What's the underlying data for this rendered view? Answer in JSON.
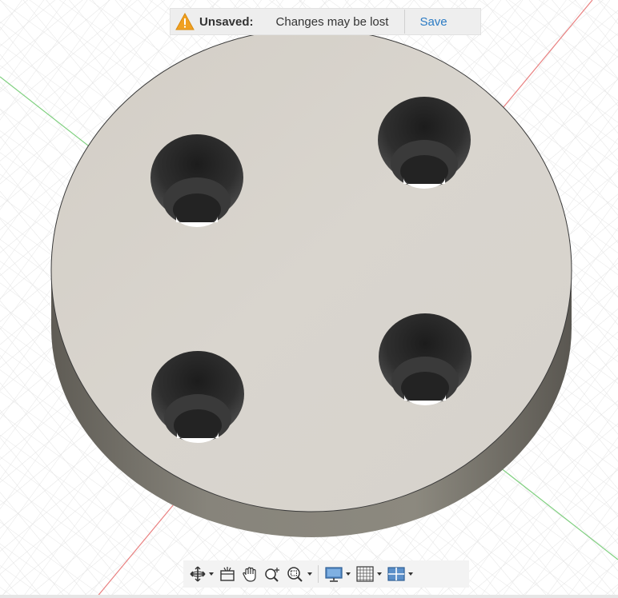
{
  "banner": {
    "status_label": "Unsaved:",
    "message": "Changes may be lost",
    "save_label": "Save"
  },
  "navbar": {
    "tools": [
      {
        "icon": "orbit-icon",
        "has_dropdown": true
      },
      {
        "icon": "look-at-icon",
        "has_dropdown": false
      },
      {
        "icon": "pan-icon",
        "has_dropdown": false
      },
      {
        "icon": "zoom-icon",
        "has_dropdown": false
      },
      {
        "icon": "fit-zoom-window-icon",
        "has_dropdown": true
      },
      {
        "icon": "display-settings-icon",
        "has_dropdown": true
      },
      {
        "icon": "grid-snaps-icon",
        "has_dropdown": true
      },
      {
        "icon": "viewports-icon",
        "has_dropdown": true
      }
    ]
  },
  "model": {
    "part": "cylindrical disc with 4 counterbored holes",
    "face_color": "#d6d2ca",
    "side_color": "#7d7a72"
  },
  "colors": {
    "grid_line": "#dcdcdc",
    "axis_x": "#e87a7a",
    "axis_y": "#78d078",
    "warning": "#f0a020",
    "save_link": "#2b7bc4"
  }
}
